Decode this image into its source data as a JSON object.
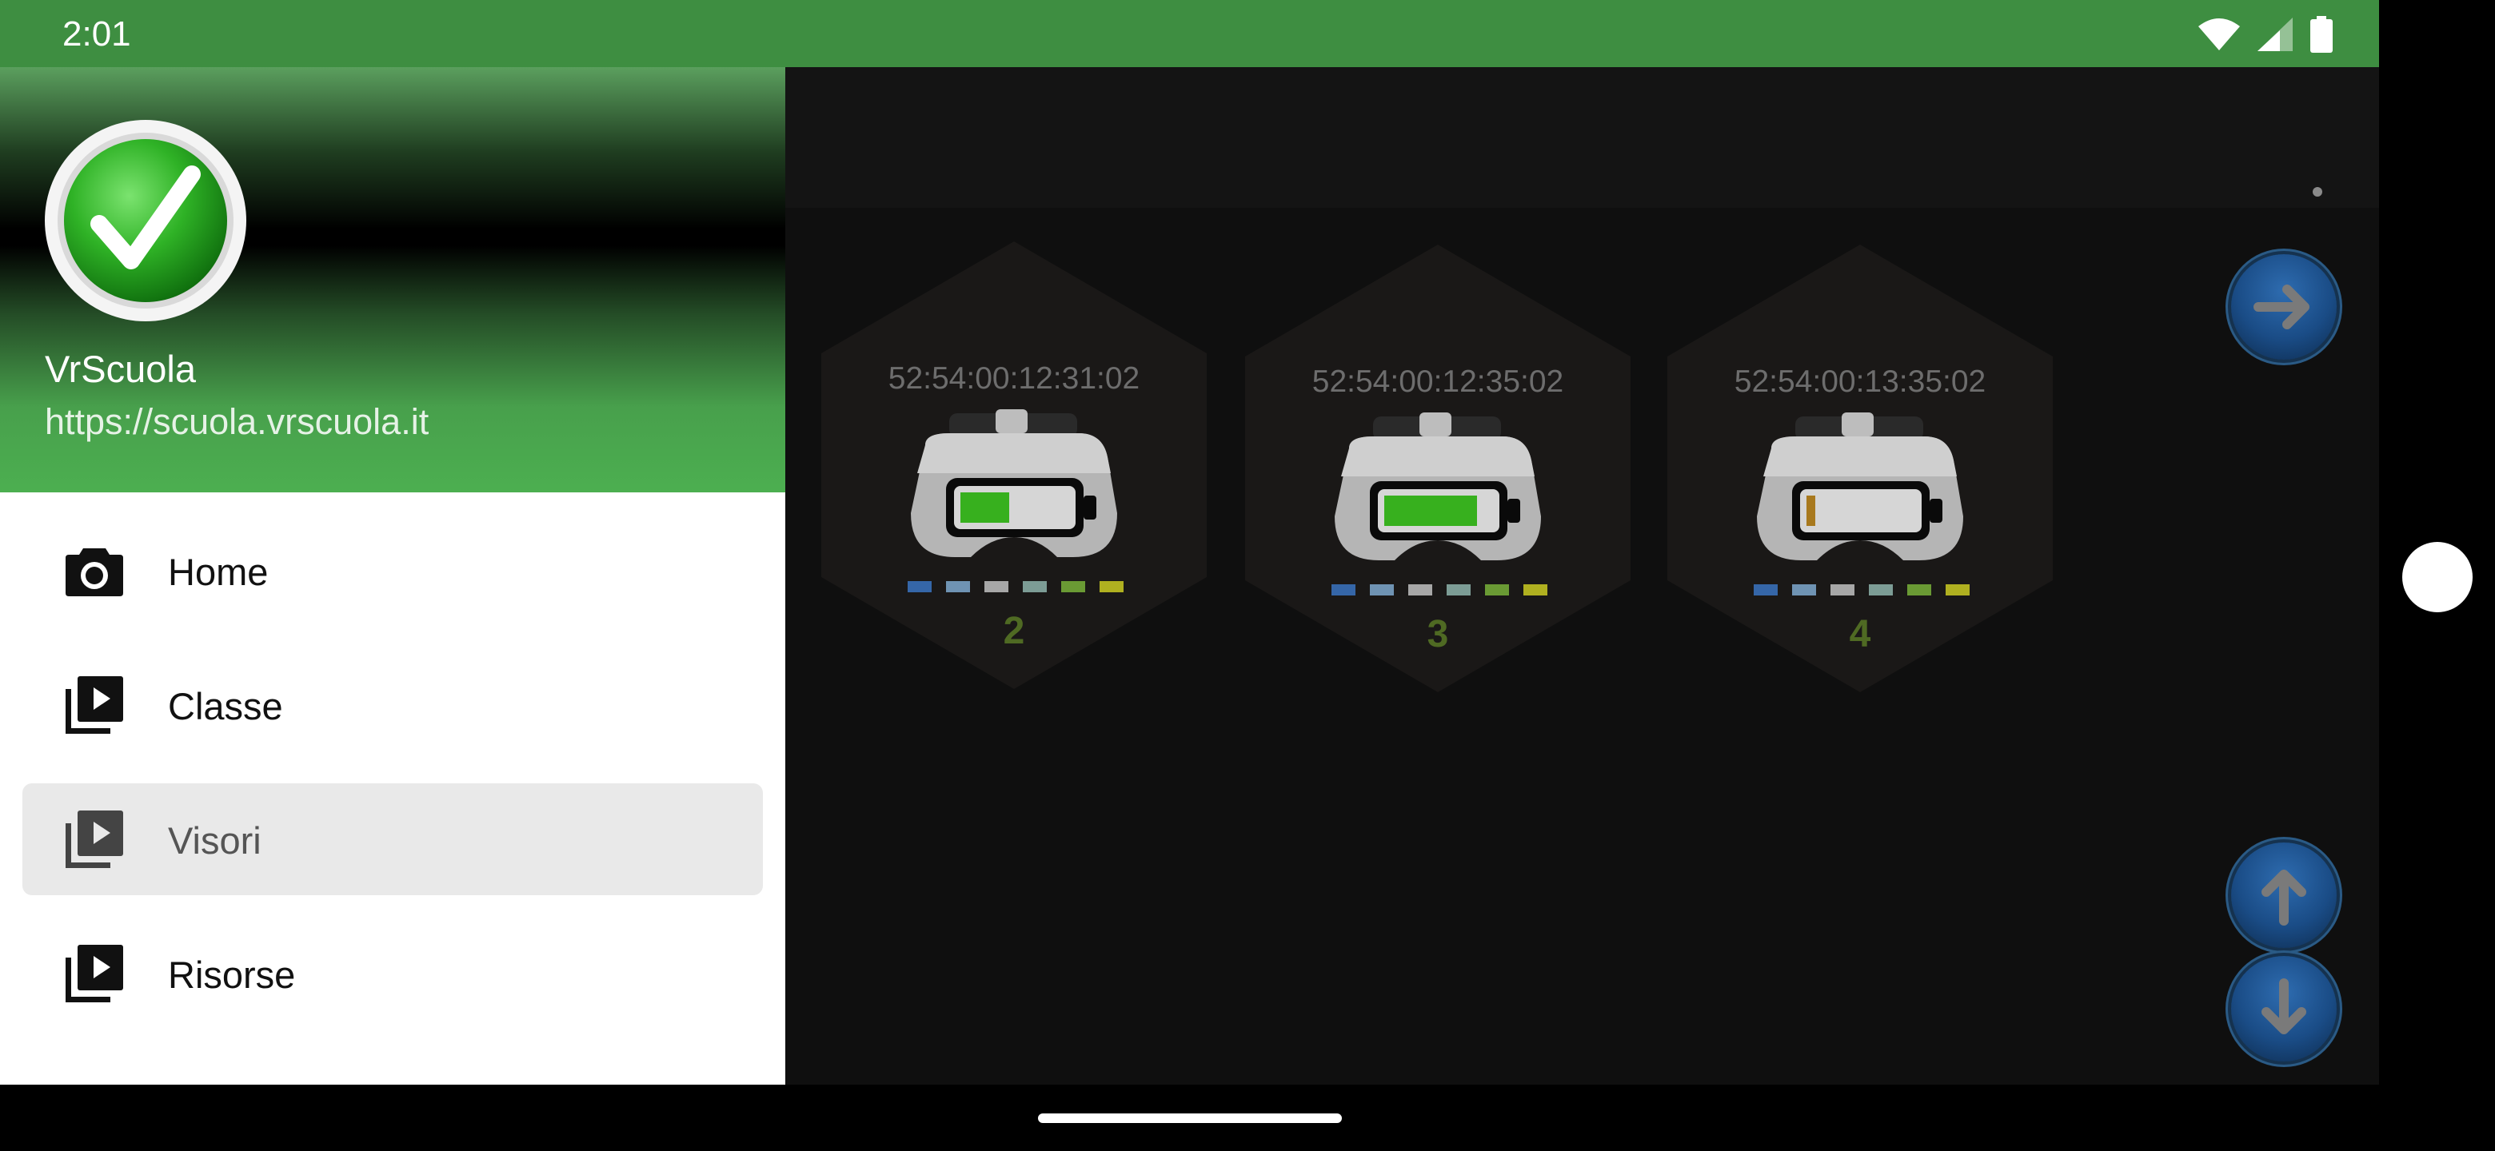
{
  "status_bar": {
    "time": "2:01"
  },
  "drawer": {
    "app_name": "VrScuola",
    "app_url": "https://scuola.vrscuola.it",
    "items": [
      {
        "label": "Home",
        "icon": "camera-icon",
        "selected": false
      },
      {
        "label": "Classe",
        "icon": "video-library-icon",
        "selected": false
      },
      {
        "label": "Visori",
        "icon": "video-library-icon",
        "selected": true
      },
      {
        "label": "Risorse",
        "icon": "video-library-icon",
        "selected": false
      }
    ]
  },
  "devices": [
    {
      "mac": "52:54:00:12:31:02",
      "number": "2",
      "battery_level": 0.45,
      "battery_color": "#37b01e"
    },
    {
      "mac": "52:54:00:12:35:02",
      "number": "3",
      "battery_level": 0.85,
      "battery_color": "#37b01e"
    },
    {
      "mac": "52:54:00:13:35:02",
      "number": "4",
      "battery_level": 0.08,
      "battery_color": "#a8791e"
    }
  ],
  "indicator_colors": [
    "#3566a8",
    "#6f93b3",
    "#a7a7a7",
    "#7c9c95",
    "#6a9a34",
    "#b0b020"
  ],
  "colors": {
    "accent": "#4caf50",
    "status_bar": "#3e8e41",
    "nav_button": "#1a4c86"
  }
}
